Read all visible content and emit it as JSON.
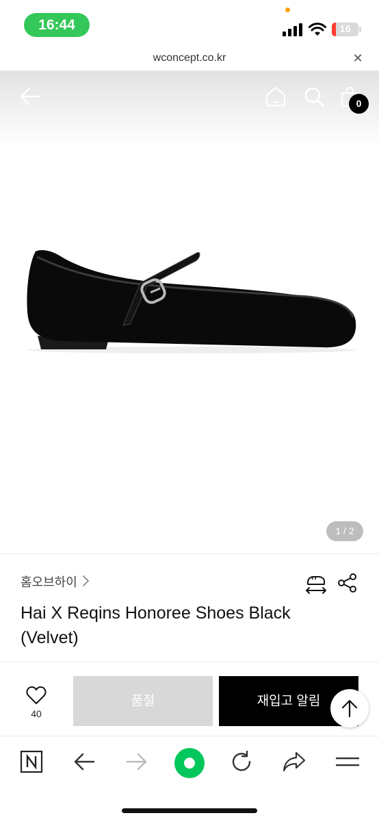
{
  "status_bar": {
    "time": "16:44",
    "battery_level": "16",
    "battery_fraction": 0.16
  },
  "browser": {
    "url": "wconcept.co.kr"
  },
  "header": {
    "cart_count": "0"
  },
  "gallery": {
    "page_indicator": "1 / 2"
  },
  "product": {
    "brand": "홈오브하이",
    "title": "Hai X Reqins Honoree Shoes Black (Velvet)"
  },
  "purchase_bar": {
    "wish_count": "40",
    "soldout_label": "품절",
    "restock_label": "재입고 알림"
  },
  "icons": [
    "back-arrow-icon",
    "home-icon",
    "search-icon",
    "shopping-bag-icon",
    "chevron-right-icon",
    "size-guide-icon",
    "share-icon",
    "heart-icon",
    "arrow-up-icon",
    "naver-logo-icon",
    "browser-back-icon",
    "browser-forward-icon",
    "green-dot-icon",
    "refresh-icon",
    "forward-share-icon",
    "menu-icon"
  ],
  "colors": {
    "status_green": "#34c759",
    "battery_red": "#ff3b30",
    "naver_green": "#03c75a"
  }
}
